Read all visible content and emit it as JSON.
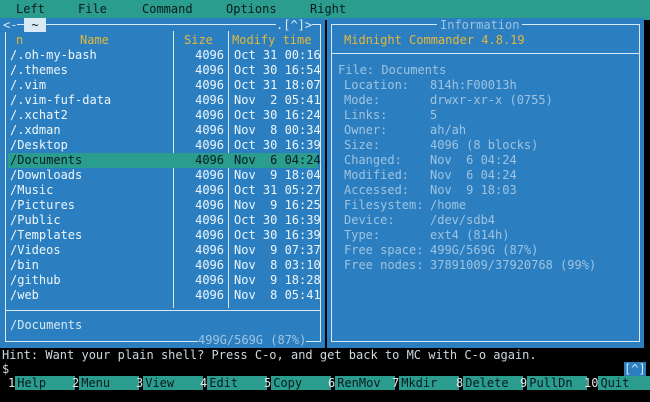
{
  "menu": [
    "Left",
    "File",
    "Command",
    "Options",
    "Right"
  ],
  "left_panel": {
    "tilde": "~",
    "corner_left": "<-",
    "corner_right": ".[^]>",
    "headers": {
      "n": "n",
      "name": "Name",
      "size": "Size",
      "modify": "Modify time"
    },
    "rows": [
      {
        "name": "/.oh-my-bash",
        "size": "4096",
        "mod": "Oct 31 00:16"
      },
      {
        "name": "/.themes",
        "size": "4096",
        "mod": "Oct 30 16:54"
      },
      {
        "name": "/.vim",
        "size": "4096",
        "mod": "Oct 31 18:07"
      },
      {
        "name": "/.vim-fuf-data",
        "size": "4096",
        "mod": "Nov  2 05:41"
      },
      {
        "name": "/.xchat2",
        "size": "4096",
        "mod": "Oct 30 16:24"
      },
      {
        "name": "/.xdman",
        "size": "4096",
        "mod": "Nov  8 00:34"
      },
      {
        "name": "/Desktop",
        "size": "4096",
        "mod": "Oct 30 16:39"
      },
      {
        "name": "/Documents",
        "size": "4096",
        "mod": "Nov  6 04:24"
      },
      {
        "name": "/Downloads",
        "size": "4096",
        "mod": "Nov  9 18:04"
      },
      {
        "name": "/Music",
        "size": "4096",
        "mod": "Oct 31 05:27"
      },
      {
        "name": "/Pictures",
        "size": "4096",
        "mod": "Nov  9 16:25"
      },
      {
        "name": "/Public",
        "size": "4096",
        "mod": "Oct 30 16:39"
      },
      {
        "name": "/Templates",
        "size": "4096",
        "mod": "Oct 30 16:39"
      },
      {
        "name": "/Videos",
        "size": "4096",
        "mod": "Nov  9 07:37"
      },
      {
        "name": "/bin",
        "size": "4096",
        "mod": "Nov  8 03:10"
      },
      {
        "name": "/github",
        "size": "4096",
        "mod": "Nov  9 18:28"
      },
      {
        "name": "/web",
        "size": "4096",
        "mod": "Nov  8 05:41"
      }
    ],
    "selected_index": 7,
    "status": "/Documents",
    "free": "499G/569G (87%)"
  },
  "right_panel": {
    "title": "Information",
    "app": "Midnight Commander 4.8.19",
    "file_line": "File: Documents",
    "fields": [
      {
        "label": "Location:",
        "value": "814h:F00013h"
      },
      {
        "label": "Mode:",
        "value": "drwxr-xr-x (0755)"
      },
      {
        "label": "Links:",
        "value": "5"
      },
      {
        "label": "Owner:",
        "value": "ah/ah"
      },
      {
        "label": "Size:",
        "value": "4096 (8 blocks)"
      },
      {
        "label": "Changed:",
        "value": "Nov  6 04:24"
      },
      {
        "label": "Modified:",
        "value": "Nov  6 04:24"
      },
      {
        "label": "Accessed:",
        "value": "Nov  9 18:03"
      },
      {
        "label": "Filesystem:",
        "value": "/home"
      },
      {
        "label": "Device:",
        "value": "/dev/sdb4"
      },
      {
        "label": "Type:",
        "value": "ext4 (814h)"
      },
      {
        "label": "Free space:",
        "value": "499G/569G (87%)"
      },
      {
        "label": "Free nodes:",
        "value": "37891009/37920768 (99%)"
      }
    ]
  },
  "hint": "Hint: Want your plain shell? Press C-o, and get back to MC with C-o again.",
  "prompt": "$",
  "prompt_corner": "[^]",
  "fkeys": [
    {
      "num": "1",
      "label": "Help"
    },
    {
      "num": "2",
      "label": "Menu"
    },
    {
      "num": "3",
      "label": "View"
    },
    {
      "num": "4",
      "label": "Edit"
    },
    {
      "num": "5",
      "label": "Copy"
    },
    {
      "num": "6",
      "label": "RenMov"
    },
    {
      "num": "7",
      "label": "Mkdir"
    },
    {
      "num": "8",
      "label": "Delete"
    },
    {
      "num": "9",
      "label": "PullDn"
    },
    {
      "num": "10",
      "label": "Quit"
    }
  ],
  "colors": {
    "menu": "#2a9d8f",
    "panel": "#2b7fc0",
    "accent": "#e3b73a"
  }
}
